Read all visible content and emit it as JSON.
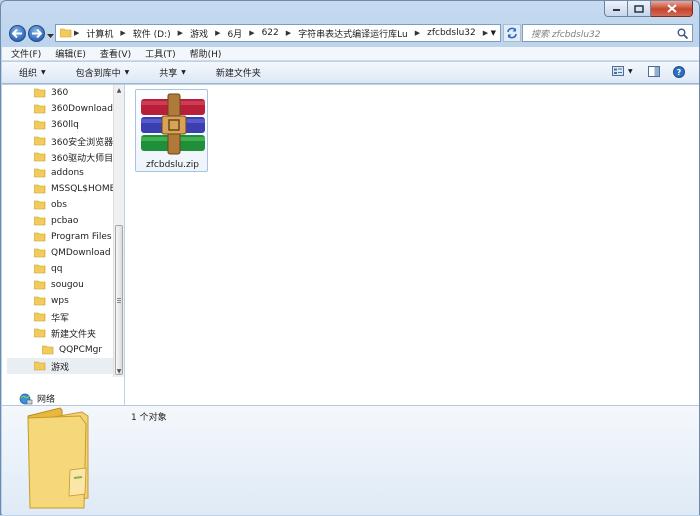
{
  "window": {
    "caption_buttons": [
      "minimize",
      "maximize",
      "close"
    ]
  },
  "address_bar": {
    "crumbs": [
      "计算机",
      "软件 (D:)",
      "游戏",
      "6月",
      "622",
      "字符串表达式编译运行库Lu",
      "zfcbdslu32"
    ]
  },
  "search": {
    "placeholder": "搜索 zfcbdslu32"
  },
  "menu": [
    "文件(F)",
    "编辑(E)",
    "查看(V)",
    "工具(T)",
    "帮助(H)"
  ],
  "commands": [
    {
      "label": "组织",
      "has_dropdown": true
    },
    {
      "label": "包含到库中",
      "has_dropdown": true
    },
    {
      "label": "共享",
      "has_dropdown": true
    },
    {
      "label": "新建文件夹",
      "has_dropdown": false
    }
  ],
  "nav_tree": [
    {
      "label": "360"
    },
    {
      "label": "360Downloads"
    },
    {
      "label": "360llq"
    },
    {
      "label": "360安全浏览器下"
    },
    {
      "label": "360驱动大师目录"
    },
    {
      "label": "addons"
    },
    {
      "label": "MSSQL$HOME"
    },
    {
      "label": "obs"
    },
    {
      "label": "pcbao"
    },
    {
      "label": "Program Files ("
    },
    {
      "label": "QMDownload"
    },
    {
      "label": "qq"
    },
    {
      "label": "sougou"
    },
    {
      "label": "wps"
    },
    {
      "label": "华军"
    },
    {
      "label": "新建文件夹"
    },
    {
      "label": "QQPCMgr"
    },
    {
      "label": "游戏",
      "selected": true
    }
  ],
  "network": {
    "label": "网络"
  },
  "files": [
    {
      "name": "zfcbdslu.zip",
      "type": "winrar-zip"
    }
  ],
  "details": {
    "count_text": "1 个对象"
  },
  "colors": {
    "folder": "#f2cb5b",
    "selection": "#e9eef3",
    "accent": "#2e69b8"
  }
}
